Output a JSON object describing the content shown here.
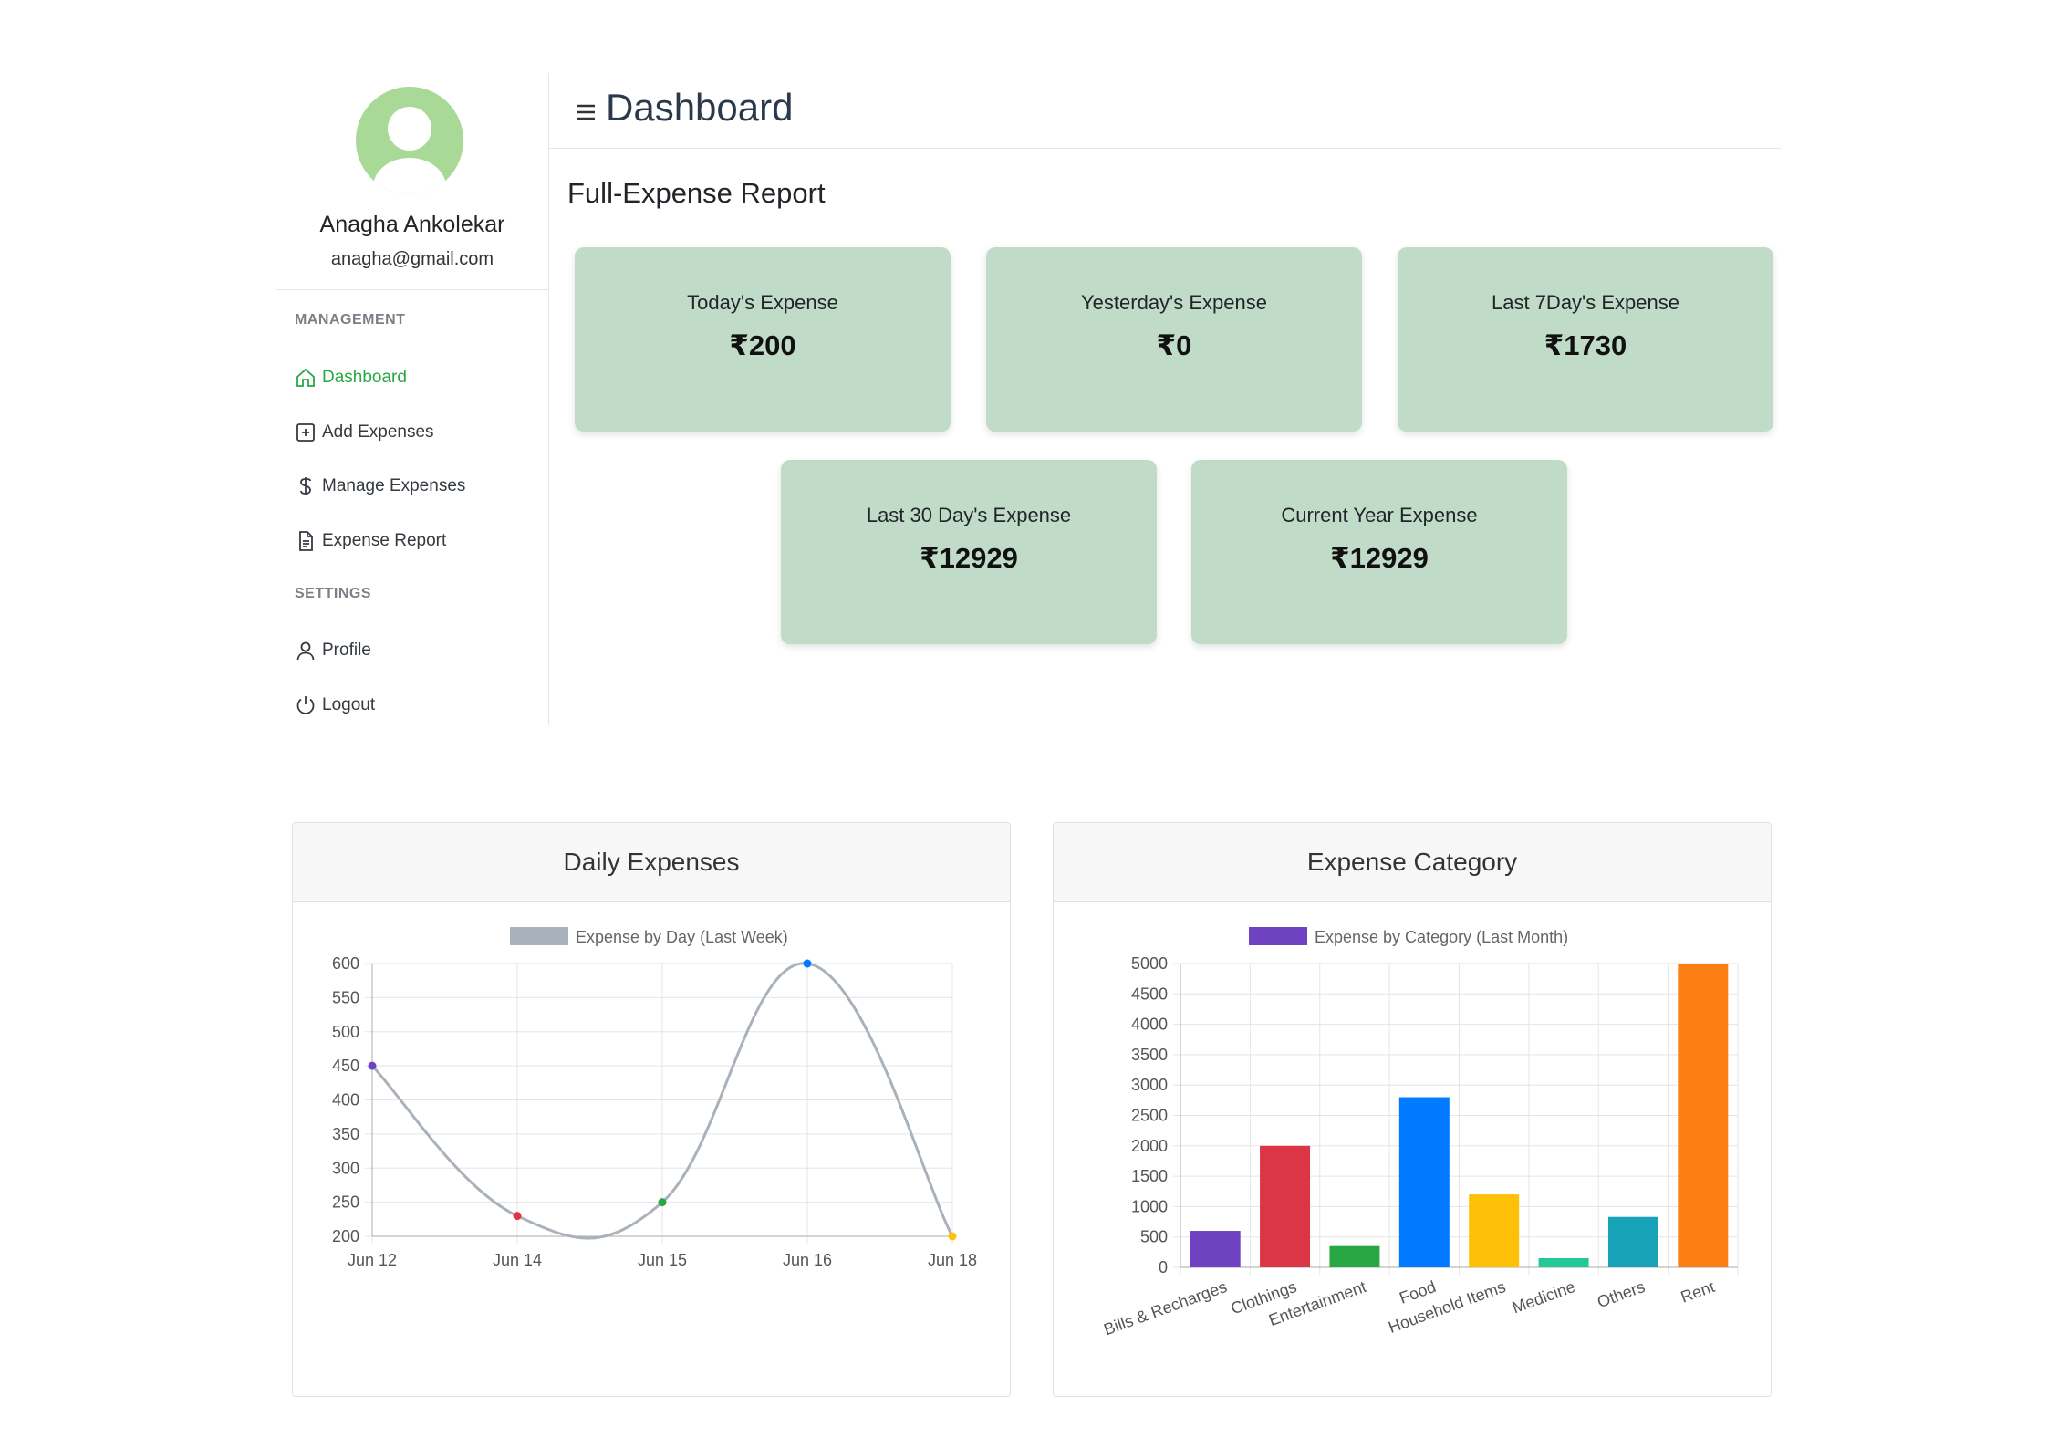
{
  "user": {
    "name": "Anagha Ankolekar",
    "email": "anagha@gmail.com"
  },
  "sidebar": {
    "sections": [
      {
        "title": "MANAGEMENT",
        "items": [
          {
            "label": "Dashboard",
            "icon": "home-icon",
            "active": true
          },
          {
            "label": "Add Expenses",
            "icon": "plus-square-icon"
          },
          {
            "label": "Manage Expenses",
            "icon": "dollar-icon"
          },
          {
            "label": "Expense Report",
            "icon": "document-icon"
          }
        ]
      },
      {
        "title": "SETTINGS",
        "items": [
          {
            "label": "Profile",
            "icon": "user-icon"
          },
          {
            "label": "Logout",
            "icon": "power-icon"
          }
        ]
      }
    ]
  },
  "header": {
    "title": "Dashboard",
    "menu_icon": "hamburger-icon"
  },
  "report": {
    "title": "Full-Expense Report",
    "cards": [
      {
        "label": "Today's Expense",
        "value": "₹200"
      },
      {
        "label": "Yesterday's Expense",
        "value": "₹0"
      },
      {
        "label": "Last 7Day's Expense",
        "value": "₹1730"
      },
      {
        "label": "Last 30 Day's Expense",
        "value": "₹12929"
      },
      {
        "label": "Current Year Expense",
        "value": "₹12929"
      }
    ]
  },
  "colors": {
    "accent": "#28a745",
    "card_bg": "#c0dcc8",
    "avatar": "#a8d996"
  },
  "chart_data": [
    {
      "type": "line",
      "title": "Daily Expenses",
      "legend": "Expense by Day (Last Week)",
      "x": [
        "Jun 12",
        "Jun 14",
        "Jun 15",
        "Jun 16",
        "Jun 18"
      ],
      "series": [
        {
          "name": "Expense by Day (Last Week)",
          "values": [
            450,
            230,
            250,
            600,
            200
          ]
        }
      ],
      "point_colors": [
        "#6f42c1",
        "#dc3545",
        "#28a745",
        "#007bff",
        "#ffc107"
      ],
      "line_color": "#a9b1bb",
      "ylim": [
        200,
        600
      ],
      "yticks": [
        200,
        250,
        300,
        350,
        400,
        450,
        500,
        550,
        600
      ],
      "grid": true,
      "legend_position": "top"
    },
    {
      "type": "bar",
      "title": "Expense Category",
      "legend": "Expense by Category (Last Month)",
      "categories": [
        "Bills & Recharges",
        "Clothings",
        "Entertainment",
        "Food",
        "Household Items",
        "Medicine",
        "Others",
        "Rent"
      ],
      "series": [
        {
          "name": "Expense by Category (Last Month)",
          "values": [
            600,
            2000,
            350,
            2800,
            1200,
            150,
            830,
            5000
          ]
        }
      ],
      "bar_colors": [
        "#6f42c1",
        "#dc3545",
        "#28a745",
        "#007bff",
        "#ffc107",
        "#20c997",
        "#17a2b8",
        "#fd7e14"
      ],
      "ylim": [
        0,
        5000
      ],
      "yticks": [
        0,
        500,
        1000,
        1500,
        2000,
        2500,
        3000,
        3500,
        4000,
        4500,
        5000
      ],
      "grid": true,
      "legend_position": "top"
    }
  ]
}
